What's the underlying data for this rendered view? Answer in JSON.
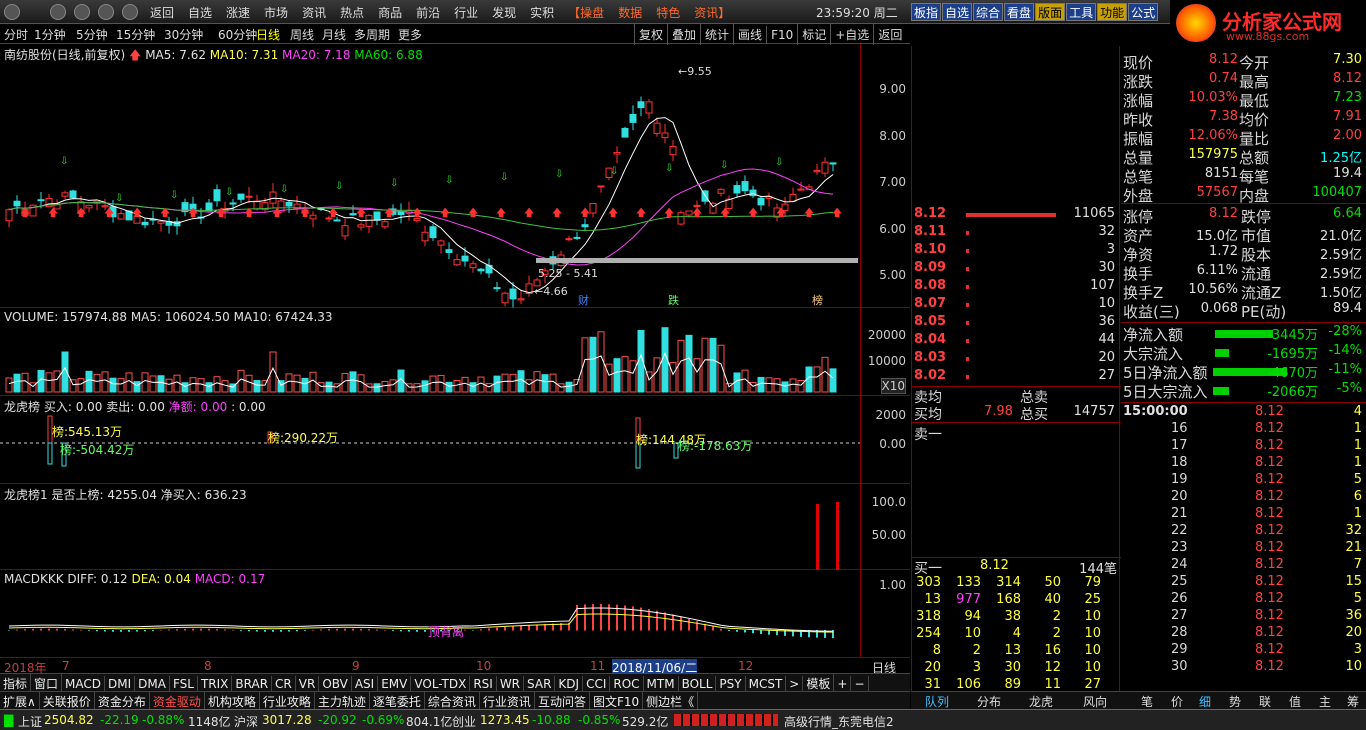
{
  "topnav": [
    "返回",
    "自选",
    "涨速",
    "市场",
    "资讯",
    "热点",
    "商品",
    "前沿",
    "行业",
    "发现",
    "实积",
    "【操盘",
    "数据",
    "特色",
    "资讯】"
  ],
  "clock": "23:59:20 周二",
  "right_tabs": [
    "板指",
    "自选",
    "综合",
    "看盘",
    "版面",
    "工具",
    "功能",
    "公式"
  ],
  "logo": {
    "title": "分析家公式网",
    "url": "www.88gs.com"
  },
  "periods": [
    "分时",
    "1分钟",
    "5分钟",
    "15分钟",
    "30分钟",
    "60分钟",
    "日线",
    "周线",
    "月线",
    "多周期",
    "更多"
  ],
  "active_period": "日线",
  "chart_buttons": [
    "复权",
    "叠加",
    "统计",
    "画线",
    "F10",
    "标记",
    "+自选",
    "返回"
  ],
  "main": {
    "title": "南纺股份(日线,前复权)",
    "ma5": "MA5: 7.62",
    "ma10": "MA10: 7.31",
    "ma20": "MA20: 7.18",
    "ma60": "MA60: 6.88",
    "y": [
      "9.00",
      "8.00",
      "7.00",
      "6.00",
      "5.00"
    ],
    "high": "9.55",
    "low": "4.66",
    "range": "5.25 - 5.41",
    "tags": [
      "财",
      "跌",
      "榜"
    ]
  },
  "volume": {
    "title": "VOLUME: 157974.88",
    "ma5": "MA5: 106024.50",
    "ma10": "MA10: 67424.33",
    "y": [
      "20000",
      "10000"
    ],
    "unit": "X10"
  },
  "lhb": {
    "title": "龙虎榜",
    "buy": "买入: 0.00",
    "sell": "卖出: 0.00",
    "net": "净额: 0.00",
    "blank": ": 0.00",
    "y": [
      "2000",
      "0.00"
    ],
    "labels": [
      "榜:545.13万",
      "榜:-504.42万",
      "榜:290.22万",
      "榜:144.48万",
      "榜:-178.63万"
    ]
  },
  "lhb1": {
    "title": "龙虎榜1",
    "on": "是否上榜: 4255.04",
    "netbuy": "净买入: 636.23",
    "y": [
      "100.0",
      "50.00"
    ]
  },
  "macd": {
    "title": "MACDKKK",
    "diff": "DIFF: 0.12",
    "dea": "DEA: 0.04",
    "macd": "MACD: 0.17",
    "y": [
      "1.00"
    ],
    "tag": "顶背离"
  },
  "dates": [
    "2018年",
    "7",
    "8",
    "9",
    "10",
    "11",
    "2018/11/06/二",
    "12",
    "日线"
  ],
  "indicators": [
    "指标",
    "窗口",
    "MACD",
    "DMI",
    "DMA",
    "FSL",
    "TRIX",
    "BRAR",
    "CR",
    "VR",
    "OBV",
    "ASI",
    "EMV",
    "VOL-TDX",
    "RSI",
    "WR",
    "SAR",
    "KDJ",
    "CCI",
    "ROC",
    "MTM",
    "BOLL",
    "PSY",
    "MCST",
    ">",
    "模板",
    "+",
    "−"
  ],
  "funcs": [
    "扩展∧",
    "关联报价",
    "资金分布",
    "资金驱动",
    "机构攻略",
    "行业攻略",
    "主力轨迹",
    "逐笔委托",
    "综合资讯",
    "行业资讯",
    "互动问答",
    "图文F10",
    "侧边栏《"
  ],
  "orderbook": {
    "sells": [
      [
        "8.12",
        "11065"
      ],
      [
        "8.11",
        "32"
      ],
      [
        "8.10",
        "3"
      ],
      [
        "8.09",
        "30"
      ],
      [
        "8.08",
        "107"
      ],
      [
        "8.07",
        "10"
      ],
      [
        "8.05",
        "36"
      ],
      [
        "8.04",
        "44"
      ],
      [
        "8.03",
        "20"
      ],
      [
        "8.02",
        "27"
      ]
    ],
    "avgsell_label": "卖均",
    "totalsell_label": "总卖",
    "avgbuy_label": "买均",
    "avgbuy": "7.98",
    "totalbuy_label": "总买",
    "totalbuy": "14757",
    "sell1": "卖一",
    "buy1_label": "买一",
    "buy1": "8.12",
    "buy1_cnt": "144笔",
    "queue": [
      [
        "303",
        "133",
        "314",
        "50",
        "79"
      ],
      [
        "13",
        "977",
        "168",
        "40",
        "25"
      ],
      [
        "318",
        "94",
        "38",
        "2",
        "10"
      ],
      [
        "254",
        "10",
        "4",
        "2",
        "10"
      ],
      [
        "8",
        "2",
        "13",
        "16",
        "10"
      ],
      [
        "20",
        "3",
        "30",
        "12",
        "10"
      ],
      [
        "31",
        "106",
        "89",
        "11",
        "27"
      ]
    ]
  },
  "quote": [
    [
      "现价",
      "8.12",
      "今开",
      "7.30"
    ],
    [
      "涨跌",
      "0.74",
      "最高",
      "8.12"
    ],
    [
      "涨幅",
      "10.03%",
      "最低",
      "7.23"
    ],
    [
      "昨收",
      "7.38",
      "均价",
      "7.91"
    ],
    [
      "振幅",
      "12.06%",
      "量比",
      "2.00"
    ],
    [
      "总量",
      "157975",
      "总额",
      "1.25亿"
    ],
    [
      "总笔",
      "8151",
      "每笔",
      "19.4"
    ],
    [
      "外盘",
      "57567",
      "内盘",
      "100407"
    ]
  ],
  "quote2": [
    [
      "涨停",
      "8.12",
      "跌停",
      "6.64"
    ],
    [
      "资产",
      "15.0亿",
      "市值",
      "21.0亿"
    ],
    [
      "净资",
      "1.72",
      "股本",
      "2.59亿"
    ],
    [
      "换手",
      "6.11%",
      "流通",
      "2.59亿"
    ],
    [
      "换手Z",
      "10.56%",
      "流通Z",
      "1.50亿"
    ],
    [
      "收益(三)",
      "0.068",
      "PE(动)",
      "89.4"
    ]
  ],
  "flows": [
    [
      "净流入额",
      "-3445万",
      "-28%"
    ],
    [
      "大宗流入",
      "-1695万",
      "-14%"
    ],
    [
      "5日净流入额",
      "-4670万",
      "-11%"
    ],
    [
      "5日大宗流入",
      "-2066万",
      "-5%"
    ]
  ],
  "ticks_head": "15:00:00",
  "ticks": [
    [
      "16",
      "8.12",
      "1"
    ],
    [
      "17",
      "8.12",
      "1"
    ],
    [
      "18",
      "8.12",
      "1"
    ],
    [
      "19",
      "8.12",
      "5"
    ],
    [
      "20",
      "8.12",
      "6"
    ],
    [
      "21",
      "8.12",
      "1"
    ],
    [
      "22",
      "8.12",
      "32"
    ],
    [
      "23",
      "8.12",
      "21"
    ],
    [
      "24",
      "8.12",
      "7"
    ],
    [
      "25",
      "8.12",
      "15"
    ],
    [
      "26",
      "8.12",
      "5"
    ],
    [
      "27",
      "8.12",
      "36"
    ],
    [
      "28",
      "8.12",
      "20"
    ],
    [
      "29",
      "8.12",
      "3"
    ],
    [
      "30",
      "8.12",
      "10"
    ]
  ],
  "ticks_first": "4",
  "bottom_tabs": [
    "队列",
    "分布",
    "龙虎",
    "风向",
    "笔",
    "价",
    "细",
    "势",
    "联",
    "值",
    "主",
    "筹"
  ],
  "status": {
    "sh": "上证",
    "sh_v": "2504.82",
    "sh_c": "-22.19",
    "sh_p": "-0.88%",
    "sh_a": "1148亿",
    "sz": "沪深",
    "sz_v": "3017.28",
    "sz_c": "-20.92",
    "sz_p": "-0.69%",
    "sz_a": "804.1亿",
    "cy": "创业",
    "cy_v": "1273.45",
    "cy_c": "-10.88",
    "cy_p": "-0.85%",
    "cy_a": "529.2亿",
    "conn": "高级行情_东莞电信2"
  }
}
